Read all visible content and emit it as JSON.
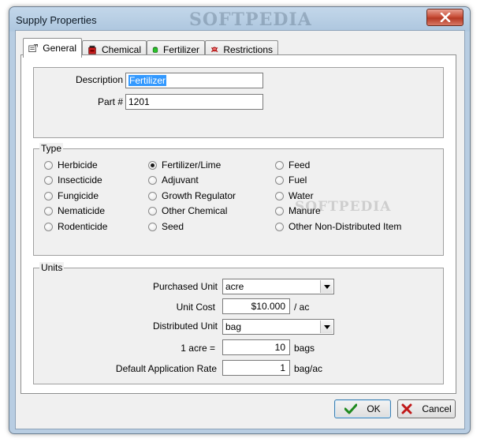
{
  "window": {
    "title": "Supply Properties",
    "watermark": "SOFTPEDIA",
    "close_label": "×"
  },
  "tabs": [
    {
      "label": "General",
      "icon": "form-icon",
      "active": true
    },
    {
      "label": "Chemical",
      "icon": "red-canister-icon",
      "active": false
    },
    {
      "label": "Fertilizer",
      "icon": "green-bag-icon",
      "active": false
    },
    {
      "label": "Restrictions",
      "icon": "skull-crossbones-icon",
      "active": false
    }
  ],
  "general": {
    "description_label": "Description",
    "description_value": "Fertilizer",
    "part_label": "Part #",
    "part_value": "1201"
  },
  "type": {
    "legend": "Type",
    "options": [
      [
        "Herbicide",
        "Fertilizer/Lime",
        "Feed"
      ],
      [
        "Insecticide",
        "Adjuvant",
        "Fuel"
      ],
      [
        "Fungicide",
        "Growth Regulator",
        "Water"
      ],
      [
        "Nematicide",
        "Other Chemical",
        "Manure"
      ],
      [
        "Rodenticide",
        "Seed",
        "Other Non-Distributed Item"
      ]
    ],
    "selected": "Fertilizer/Lime",
    "watermark": "SOFTPEDIA"
  },
  "units": {
    "legend": "Units",
    "purchased_unit_label": "Purchased Unit",
    "purchased_unit_value": "acre",
    "unit_cost_label": "Unit Cost",
    "unit_cost_value": "$10.000",
    "unit_cost_suffix": "/ ac",
    "distributed_unit_label": "Distributed Unit",
    "distributed_unit_value": "bag",
    "conversion_label": "1 acre =",
    "conversion_value": "10",
    "conversion_suffix": "bags",
    "default_rate_label": "Default Application Rate",
    "default_rate_value": "1",
    "default_rate_suffix": "bag/ac"
  },
  "buttons": {
    "ok_label": "OK",
    "cancel_label": "Cancel"
  },
  "colors": {
    "ok_check": "#1f8a1f",
    "cancel_x": "#c01818",
    "selection": "#3399ff"
  }
}
